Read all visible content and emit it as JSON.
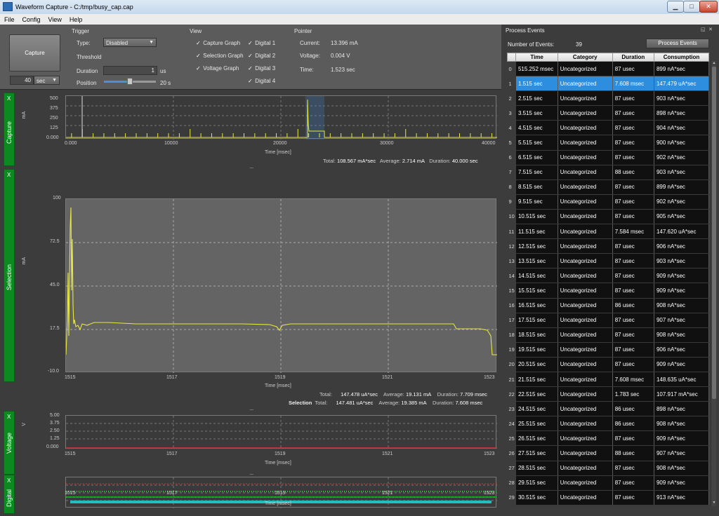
{
  "window": {
    "title": "Waveform Capture - C:/tmp/busy_cap.cap",
    "minimize": "▁",
    "maximize": "□",
    "close": "✕"
  },
  "menu": [
    "File",
    "Config",
    "View",
    "Help"
  ],
  "capture": {
    "button": "Capture",
    "duration_value": "40",
    "duration_unit": "sec"
  },
  "trigger": {
    "header": "Trigger",
    "type_label": "Type:",
    "type_value": "Disabled",
    "threshold_label": "Threshold",
    "duration_label": "Duration",
    "duration_value": "1",
    "duration_unit": "us",
    "position_label": "Position",
    "position_value": "20 s"
  },
  "view": {
    "header": "View",
    "checks": [
      {
        "label": "Capture Graph",
        "checked": true
      },
      {
        "label": "Selection Graph",
        "checked": true
      },
      {
        "label": "Voltage Graph",
        "checked": true
      },
      {
        "label": "Digital 1",
        "checked": true
      },
      {
        "label": "Digital 2",
        "checked": true
      },
      {
        "label": "Digital 3",
        "checked": true
      },
      {
        "label": "Digital 4",
        "checked": true
      }
    ],
    "check_mark": "✓"
  },
  "pointer": {
    "header": "Pointer",
    "current_label": "Current:",
    "current_value": "13.396 mA",
    "voltage_label": "Voltage:",
    "voltage_value": "0.004 V",
    "time_label": "Time:",
    "time_value": "1.523 sec"
  },
  "graphs": {
    "close_glyph": "X",
    "grip": "......",
    "capture": {
      "name": "Capture",
      "unit": "mA",
      "yticks": [
        "500",
        "375",
        "250",
        "125",
        "0.000"
      ],
      "xticks": [
        "0.000",
        "10000",
        "20000",
        "30000",
        "40000"
      ],
      "xlabel": "Time [msec]",
      "total_label": "Total:",
      "total_value": "108.567 mA*sec",
      "avg_label": "Average:",
      "avg_value": "2.714 mA",
      "dur_label": "Duration:",
      "dur_value": "40.000 sec"
    },
    "selection": {
      "name": "Selection",
      "unit": "mA",
      "yticks": [
        "100",
        "72.5",
        "45.0",
        "17.5",
        "-10.0"
      ],
      "xticks": [
        "1515",
        "1517",
        "1519",
        "1521",
        "1523"
      ],
      "xlabel": "Time [msec]",
      "row1": {
        "prefix": "",
        "total_label": "Total:",
        "total_value": "147.478 uA*sec",
        "avg_label": "Average:",
        "avg_value": "19.131 mA",
        "dur_label": "Duration:",
        "dur_value": "7.709 msec"
      },
      "row2": {
        "prefix": "Selection",
        "total_label": "Total:",
        "total_value": "147.481 uA*sec",
        "avg_label": "Average:",
        "avg_value": "19.385 mA",
        "dur_label": "Duration:",
        "dur_value": "7.608 msec"
      }
    },
    "voltage": {
      "name": "Voltage",
      "unit": "V",
      "yticks": [
        "5.00",
        "3.75",
        "2.50",
        "1.25",
        "0.000"
      ],
      "xticks": [
        "1515",
        "1517",
        "1519",
        "1521",
        "1523"
      ],
      "xlabel": "Time [msec]"
    },
    "digital": {
      "name": "Digital",
      "xticks": [
        "1515",
        "1517",
        "1519",
        "1521",
        "1523"
      ],
      "xlabel": "Time [msec]"
    }
  },
  "events": {
    "header": "Process Events",
    "count_label": "Number of Events:",
    "count_value": "39",
    "button": "Process Events",
    "columns": [
      "Time",
      "Category",
      "Duration",
      "Consumption"
    ],
    "selected_index": 1,
    "rows": [
      [
        "0",
        "515.252 msec",
        "Uncategorized",
        "87 usec",
        "899 nA*sec"
      ],
      [
        "1",
        "1.515 sec",
        "Uncategorized",
        "7.608 msec",
        "147.479 uA*sec"
      ],
      [
        "2",
        "2.515 sec",
        "Uncategorized",
        "87 usec",
        "903 nA*sec"
      ],
      [
        "3",
        "3.515 sec",
        "Uncategorized",
        "87 usec",
        "898 nA*sec"
      ],
      [
        "4",
        "4.515 sec",
        "Uncategorized",
        "87 usec",
        "904 nA*sec"
      ],
      [
        "5",
        "5.515 sec",
        "Uncategorized",
        "87 usec",
        "900 nA*sec"
      ],
      [
        "6",
        "6.515 sec",
        "Uncategorized",
        "87 usec",
        "902 nA*sec"
      ],
      [
        "7",
        "7.515 sec",
        "Uncategorized",
        "88 usec",
        "903 nA*sec"
      ],
      [
        "8",
        "8.515 sec",
        "Uncategorized",
        "87 usec",
        "899 nA*sec"
      ],
      [
        "9",
        "9.515 sec",
        "Uncategorized",
        "87 usec",
        "902 nA*sec"
      ],
      [
        "10",
        "10.515 sec",
        "Uncategorized",
        "87 usec",
        "905 nA*sec"
      ],
      [
        "11",
        "11.515 sec",
        "Uncategorized",
        "7.584 msec",
        "147.620 uA*sec"
      ],
      [
        "12",
        "12.515 sec",
        "Uncategorized",
        "87 usec",
        "906 nA*sec"
      ],
      [
        "13",
        "13.515 sec",
        "Uncategorized",
        "87 usec",
        "903 nA*sec"
      ],
      [
        "14",
        "14.515 sec",
        "Uncategorized",
        "87 usec",
        "909 nA*sec"
      ],
      [
        "15",
        "15.515 sec",
        "Uncategorized",
        "87 usec",
        "909 nA*sec"
      ],
      [
        "16",
        "16.515 sec",
        "Uncategorized",
        "86 usec",
        "908 nA*sec"
      ],
      [
        "17",
        "17.515 sec",
        "Uncategorized",
        "87 usec",
        "907 nA*sec"
      ],
      [
        "18",
        "18.515 sec",
        "Uncategorized",
        "87 usec",
        "908 nA*sec"
      ],
      [
        "19",
        "19.515 sec",
        "Uncategorized",
        "87 usec",
        "906 nA*sec"
      ],
      [
        "20",
        "20.515 sec",
        "Uncategorized",
        "87 usec",
        "909 nA*sec"
      ],
      [
        "21",
        "21.515 sec",
        "Uncategorized",
        "7.608 msec",
        "148.635 uA*sec"
      ],
      [
        "22",
        "22.515 sec",
        "Uncategorized",
        "1.783 sec",
        "107.917 mA*sec"
      ],
      [
        "23",
        "24.515 sec",
        "Uncategorized",
        "86 usec",
        "898 nA*sec"
      ],
      [
        "24",
        "25.515 sec",
        "Uncategorized",
        "86 usec",
        "908 nA*sec"
      ],
      [
        "25",
        "26.515 sec",
        "Uncategorized",
        "87 usec",
        "909 nA*sec"
      ],
      [
        "26",
        "27.515 sec",
        "Uncategorized",
        "88 usec",
        "907 nA*sec"
      ],
      [
        "27",
        "28.515 sec",
        "Uncategorized",
        "87 usec",
        "908 nA*sec"
      ],
      [
        "28",
        "29.515 sec",
        "Uncategorized",
        "87 usec",
        "909 nA*sec"
      ],
      [
        "29",
        "30.515 sec",
        "Uncategorized",
        "87 usec",
        "913 nA*sec"
      ]
    ]
  },
  "colors": {
    "trace": "#e8e840",
    "selection": "#3a86d8",
    "voltage": "#e03030",
    "strip": "#0c8a1f",
    "digital_green": "#2ecc40",
    "digital_cyan": "#20c0c0"
  }
}
